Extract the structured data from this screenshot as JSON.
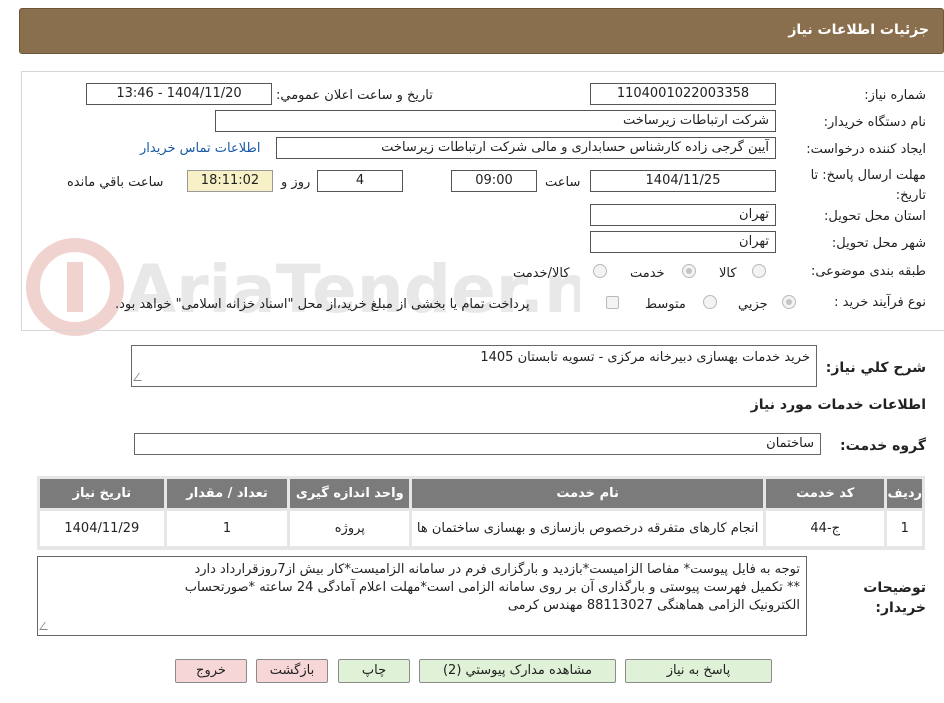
{
  "header": {
    "title": "جزئيات اطلاعات نياز"
  },
  "form": {
    "need_number_label": "شماره نياز:",
    "need_number": "1104001022003358",
    "announce_label": "تاريخ و ساعت اعلان عمومي:",
    "announce_value": "1404/11/20 - 13:46",
    "buyer_org_label": "نام دستگاه خريدار:",
    "buyer_org": "شرکت ارتباطات زیرساخت",
    "requester_label": "ايجاد کننده درخواست:",
    "requester": "آیین گرجی زاده کارشناس حسابداری و مالی شرکت ارتباطات زیرساخت",
    "buyer_contact_link": "اطلاعات تماس خريدار",
    "deadline_label": "مهلت ارسال پاسخ: تا تاريخ:",
    "deadline_date": "1404/11/25",
    "time_label": "ساعت",
    "deadline_time": "09:00",
    "days_value": "4",
    "days_label": "روز و",
    "remaining_time": "18:11:02",
    "remaining_label": "ساعت باقي مانده",
    "province_label": "استان محل تحويل:",
    "province": "تهران",
    "city_label": "شهر محل تحويل:",
    "city": "تهران",
    "category_label": "طبقه بندی موضوعی:",
    "category_options": [
      "کالا",
      "خدمت",
      "کالا/خدمت"
    ],
    "process_label": "نوع فرآیند خرید :",
    "process_options": [
      "جزيي",
      "متوسط"
    ],
    "payment_note": "پرداخت تمام یا بخشی از مبلغ خرید،از محل \"اسناد خزانه اسلامی\" خواهد بود."
  },
  "description": {
    "label": "شرح کلي نياز:",
    "value": "خرید خدمات بهسازی دبیرخانه مرکزی -    تسویه تابستان 1405"
  },
  "services": {
    "title": "اطلاعات خدمات مورد نياز",
    "group_label": "گروه خدمت:",
    "group_value": "ساختمان",
    "columns": [
      "رديف",
      "کد خدمت",
      "نام خدمت",
      "واحد اندازه گيری",
      "تعداد / مقدار",
      "تاريخ نياز"
    ],
    "rows": [
      [
        "1",
        "ج-44",
        "انجام کارهای متفرقه درخصوص بازسازی و بهسازی ساختمان ها",
        "پروژه",
        "1",
        "1404/11/29"
      ]
    ]
  },
  "notes": {
    "label": "توضيحات خريدار:",
    "lines": [
      "توجه به فایل پیوست* مفاصا الزامیست*بازدید و بارگزاری فرم در سامانه الزامیست*کار بیش از7روزقرارداد دارد",
      "** تکمیل فهرست پیوستی و بارگذاری آن بر روی سامانه الزامی است*مهلت اعلام آمادگی 24 ساعته *صورتحساب",
      "الکترونیک الزامی هماهنگی 88113027 مهندس کرمی"
    ]
  },
  "buttons": {
    "reply": "پاسخ به نياز",
    "attachments": "مشاهده مدارک پيوستي (2)",
    "print": "چاپ",
    "back": "بازگشت",
    "exit": "خروج"
  },
  "watermark": {
    "text": "AriaTender.neT"
  },
  "colors": {
    "header": "#8a6f4e",
    "table_header": "#7b7b7b",
    "link": "#1a5aa6",
    "button_green": "#dff1d6",
    "button_red": "#f6d6d6"
  }
}
